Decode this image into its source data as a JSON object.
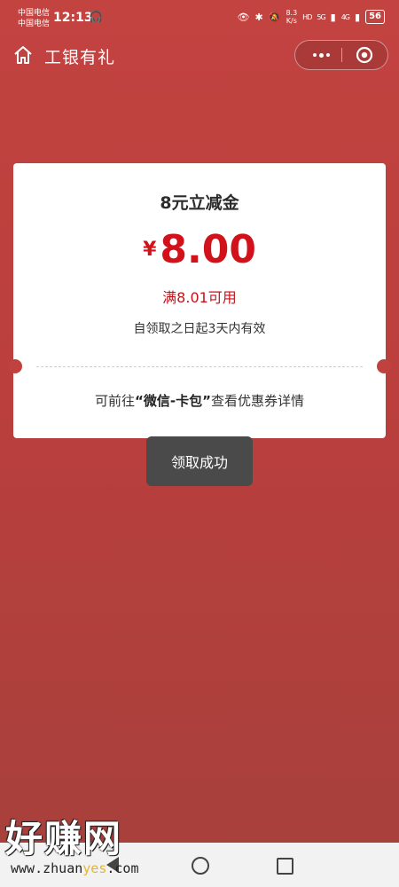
{
  "status_bar": {
    "carrier1": "中国电信",
    "carrier2": "中国电信",
    "time": "12:13",
    "net_speed_value": "8.3",
    "net_speed_unit": "K/s",
    "hd": "HD",
    "sig1": "5G",
    "sig2": "4G",
    "battery": "56"
  },
  "nav": {
    "title": "工银有礼"
  },
  "coupon": {
    "title": "8元立减金",
    "currency": "¥",
    "amount": "8.00",
    "condition": "满8.01可用",
    "validity": "自领取之日起3天内有效",
    "hint_prefix": "可前往",
    "hint_bold": "“微信-卡包”",
    "hint_suffix": "查看优惠券详情"
  },
  "toast": {
    "message": "领取成功"
  },
  "watermark": {
    "text": "好赚网",
    "url_prefix": "www.zhuan",
    "url_highlight": "yes",
    "url_suffix": ".com"
  },
  "colors": {
    "background": "#b8403e",
    "accent_red": "#d2121b",
    "toast_bg": "#4a4a4a"
  }
}
